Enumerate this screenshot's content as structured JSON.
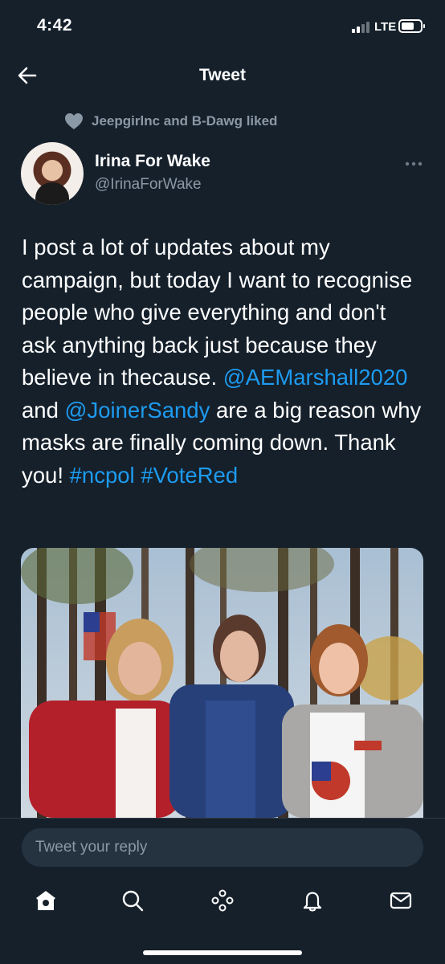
{
  "status_bar": {
    "time": "4:42",
    "network": "LTE"
  },
  "header": {
    "title": "Tweet",
    "back_icon": "arrow-left-icon"
  },
  "social_context": {
    "icon": "heart-icon",
    "text": "Jeepgirlnc and B-Dawg liked"
  },
  "tweet": {
    "author_name": "Irina For Wake",
    "author_handle": "@IrinaForWake",
    "more_icon": "more-dots-icon",
    "text_part1": "I post a lot of updates about my campaign, but today I want to recognise people who give everything and don't ask anything back just because they believe in thecause. ",
    "mention1": "@AEMarshall2020",
    "text_part2": " and ",
    "mention2": "@JoinerSandy",
    "text_part3": " are a big reason why masks are finally coming down. Thank you! ",
    "hashtag1": "#ncpol",
    "text_part4": " ",
    "hashtag2": "#VoteRed"
  },
  "reply": {
    "placeholder": "Tweet your reply"
  },
  "nav": {
    "items": [
      "home-icon",
      "search-icon",
      "spaces-icon",
      "notifications-icon",
      "messages-icon"
    ]
  },
  "colors": {
    "background": "#15202b",
    "text": "#ffffff",
    "secondary": "#8b98a5",
    "link": "#1d9bf0",
    "input_bg": "#253341"
  }
}
